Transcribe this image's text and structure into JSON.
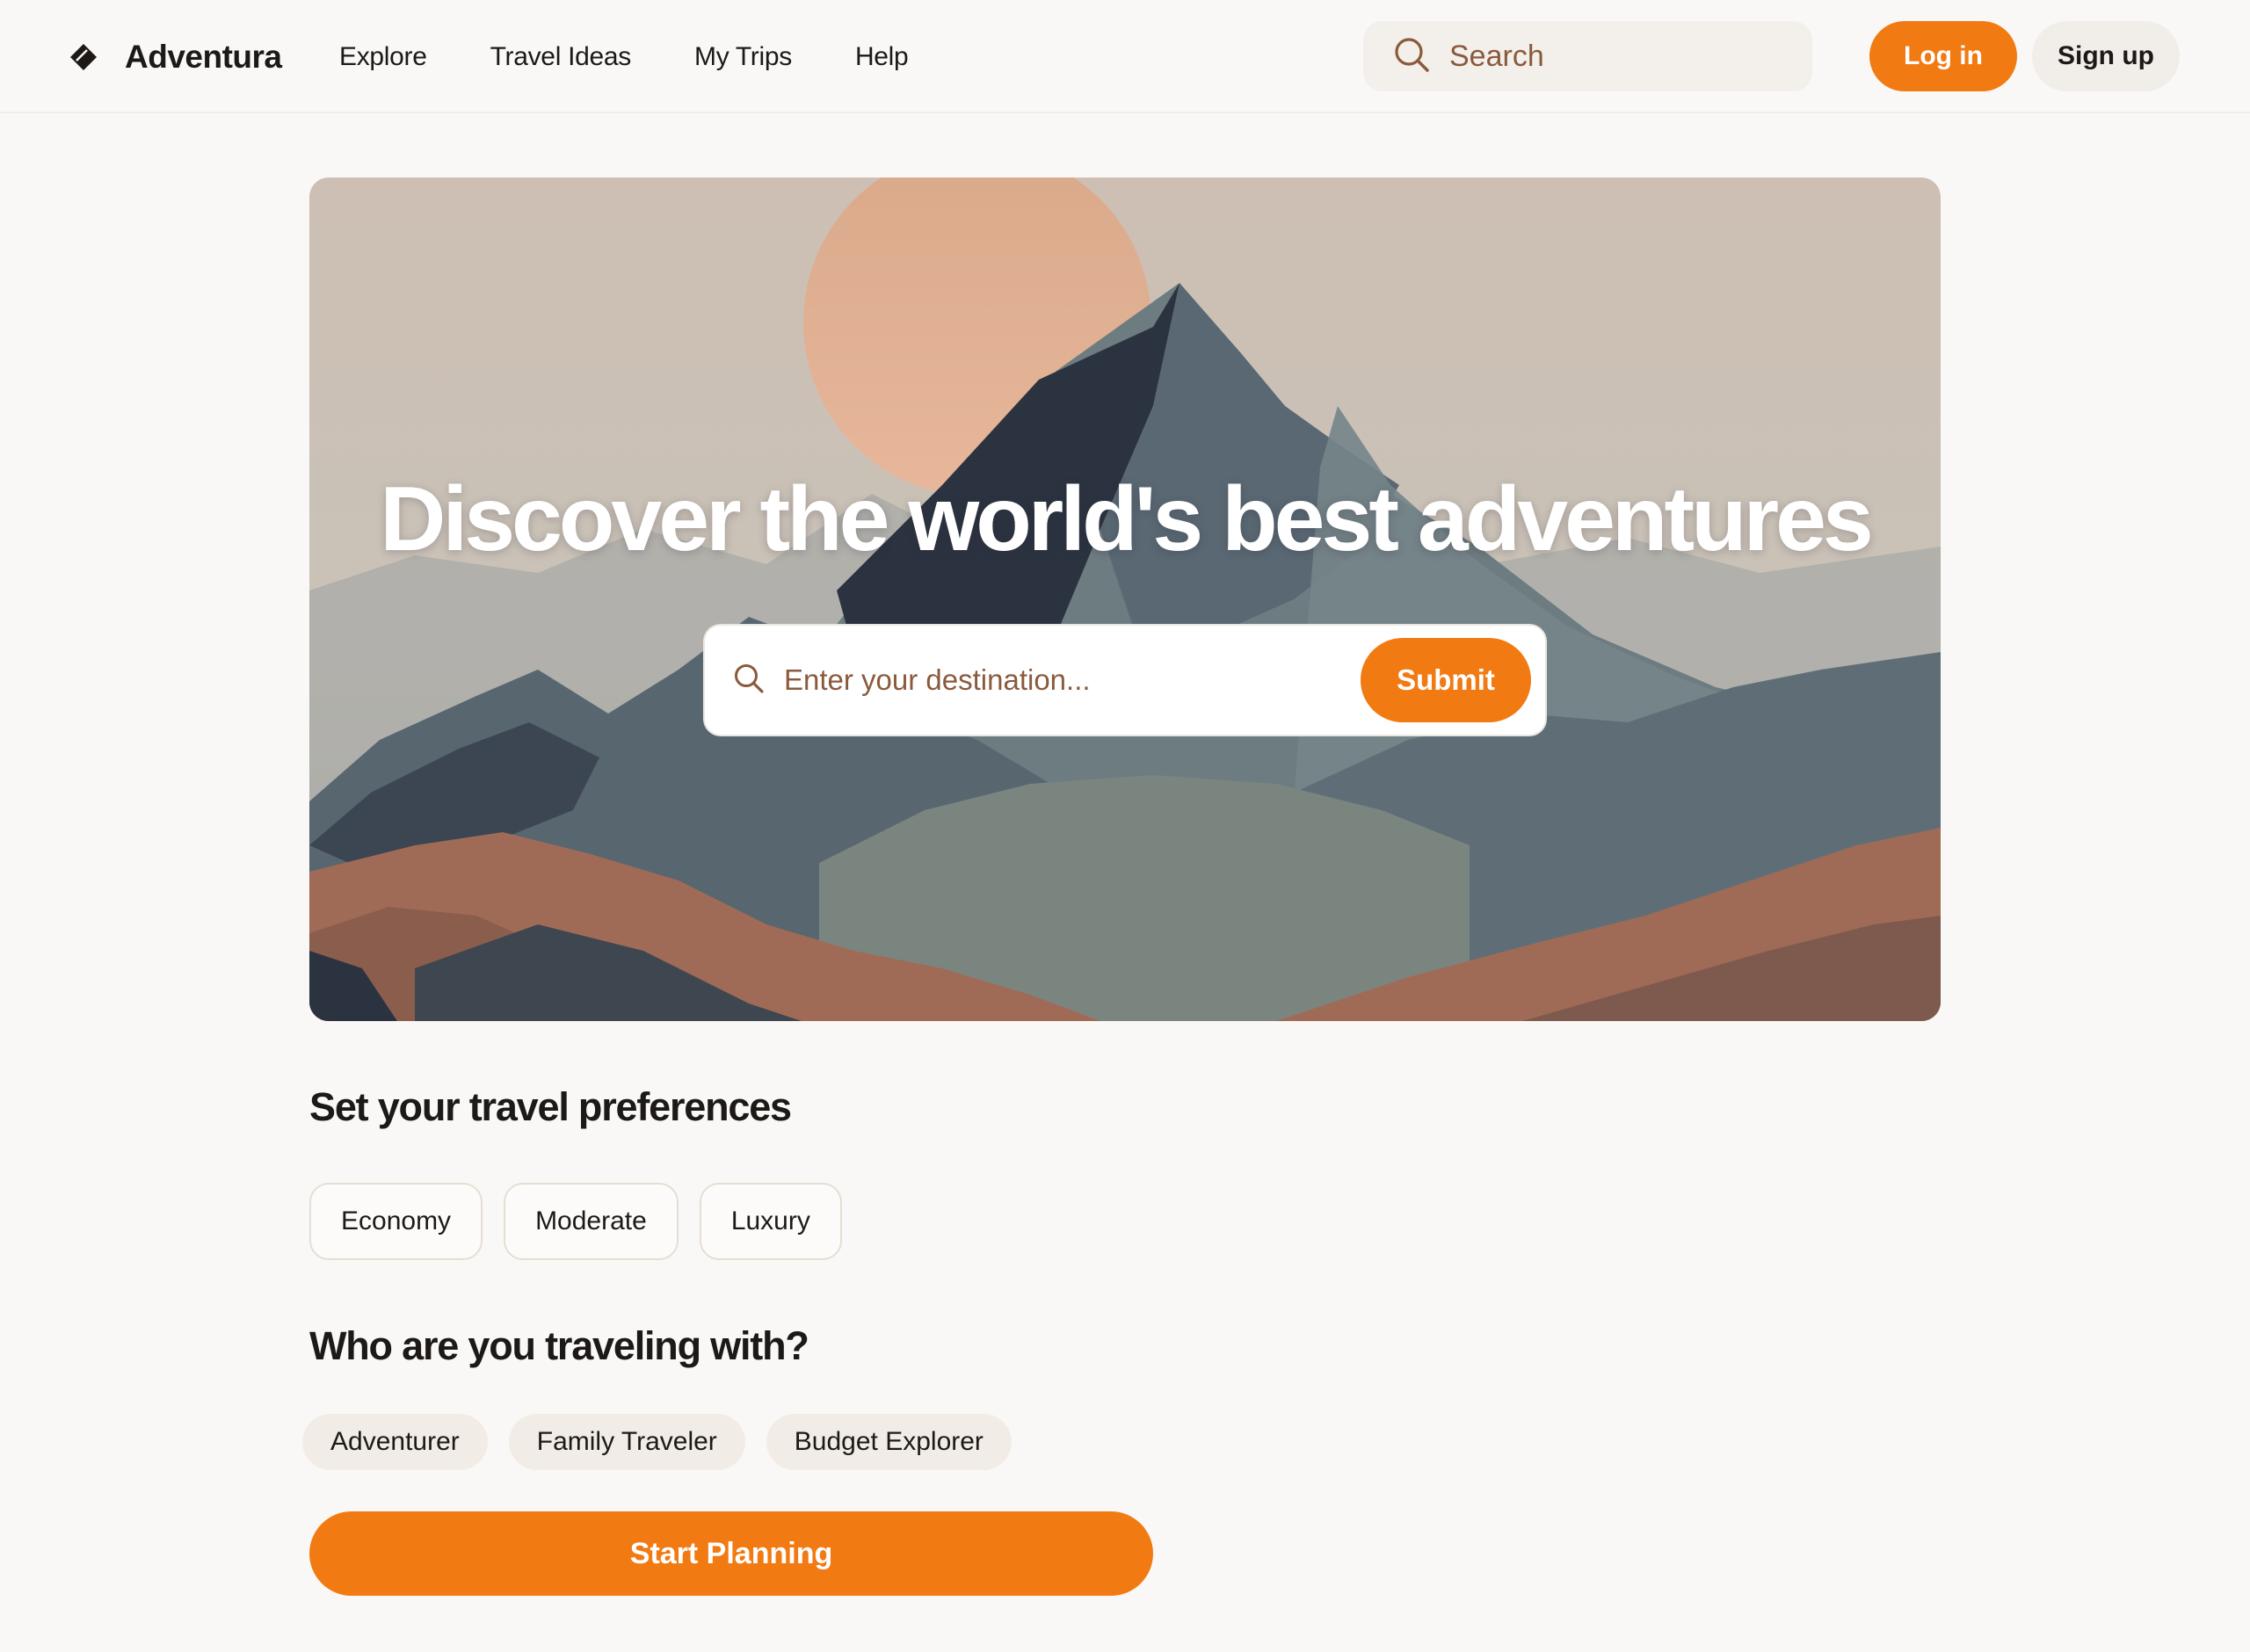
{
  "header": {
    "brand": "Adventura",
    "nav": [
      {
        "label": "Explore"
      },
      {
        "label": "Travel Ideas"
      },
      {
        "label": "My Trips"
      },
      {
        "label": "Help"
      }
    ],
    "search_placeholder": "Search",
    "login_label": "Log in",
    "signup_label": "Sign up"
  },
  "hero": {
    "title": "Discover the world's best adventures",
    "search_placeholder": "Enter your destination...",
    "submit_label": "Submit"
  },
  "preferences": {
    "title": "Set your travel preferences",
    "options": [
      "Economy",
      "Moderate",
      "Luxury"
    ]
  },
  "companions": {
    "title": "Who are you traveling with?",
    "options": [
      "Adventurer",
      "Family Traveler",
      "Budget Explorer"
    ]
  },
  "cta": {
    "label": "Start Planning"
  },
  "colors": {
    "accent": "#f27a12",
    "background": "#faf8f6",
    "chip": "#f1ece6"
  },
  "icons": {
    "brand": "diamond-logo-icon",
    "search": "search-icon"
  }
}
